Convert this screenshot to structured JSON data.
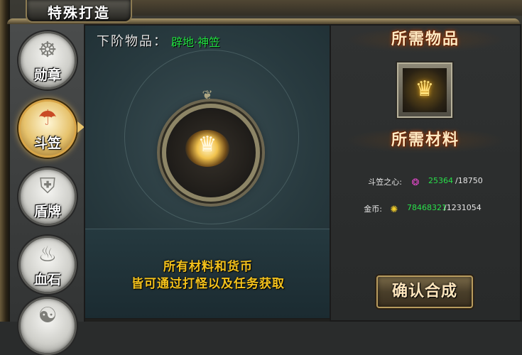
{
  "window": {
    "title": "特殊打造"
  },
  "sidebar": {
    "items": [
      {
        "label": "勋章",
        "icon": "medal-icon",
        "glyph": "☸",
        "active": false
      },
      {
        "label": "斗笠",
        "icon": "bamboo-hat-icon",
        "glyph": "☂",
        "active": true
      },
      {
        "label": "盾牌",
        "icon": "shield-icon",
        "glyph": "⛨",
        "active": false
      },
      {
        "label": "血石",
        "icon": "blood-stone-icon",
        "glyph": "♨",
        "active": false
      },
      {
        "label": "",
        "icon": "more-item-icon",
        "glyph": "☯",
        "active": false
      }
    ]
  },
  "center": {
    "next_label": "下阶物品：",
    "next_value": "辟地·神笠",
    "item_icon": "bamboo-hat-item-icon",
    "hint_line1": "所有材料和货币",
    "hint_line2": "皆可通过打怪以及任务获取"
  },
  "right": {
    "required_item_title": "所需物品",
    "required_materials_title": "所需材料",
    "required_item_icon": "golden-hat-icon",
    "materials": [
      {
        "name": "斗笠之心:",
        "icon": "heart-gem-icon",
        "have": "25364",
        "need": "/18750"
      },
      {
        "name": "金币:",
        "icon": "gold-coin-icon",
        "have": "78468321",
        "need": "/1231054"
      }
    ],
    "confirm_label": "确认合成"
  },
  "colors": {
    "accent_gold": "#f4c21c",
    "enough_green": "#28e04a",
    "item_name_green": "#22e042"
  }
}
